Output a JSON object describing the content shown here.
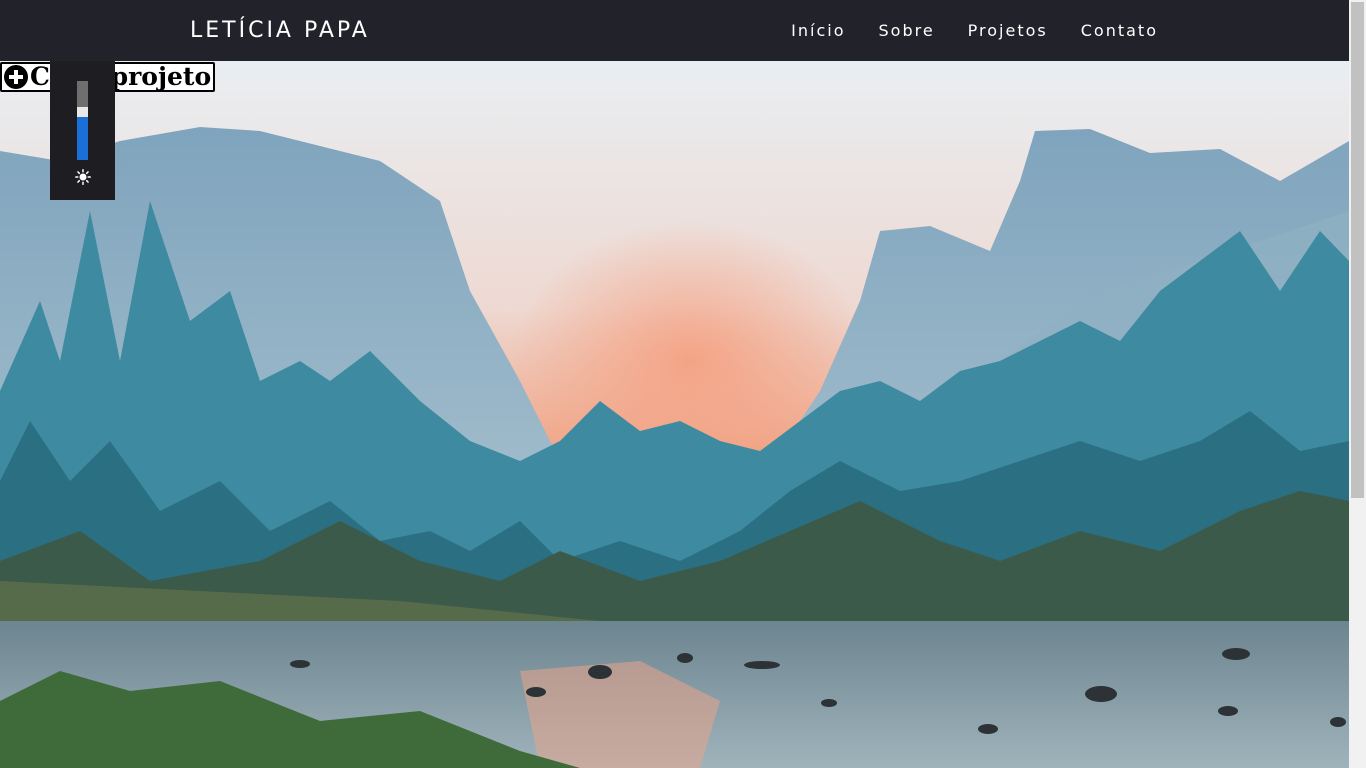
{
  "header": {
    "brand": "LETÍCIA PAPA",
    "nav": [
      {
        "label": "Início"
      },
      {
        "label": "Sobre"
      },
      {
        "label": "Projetos"
      },
      {
        "label": "Contato"
      }
    ]
  },
  "actions": {
    "create_project_label": "Criar projeto",
    "create_project_icon": "plus-circle-icon"
  },
  "brightness": {
    "icon": "sun-icon",
    "level": 0.55
  },
  "colors": {
    "navbar_bg": "#22222a",
    "accent": "#1a6fd8"
  }
}
